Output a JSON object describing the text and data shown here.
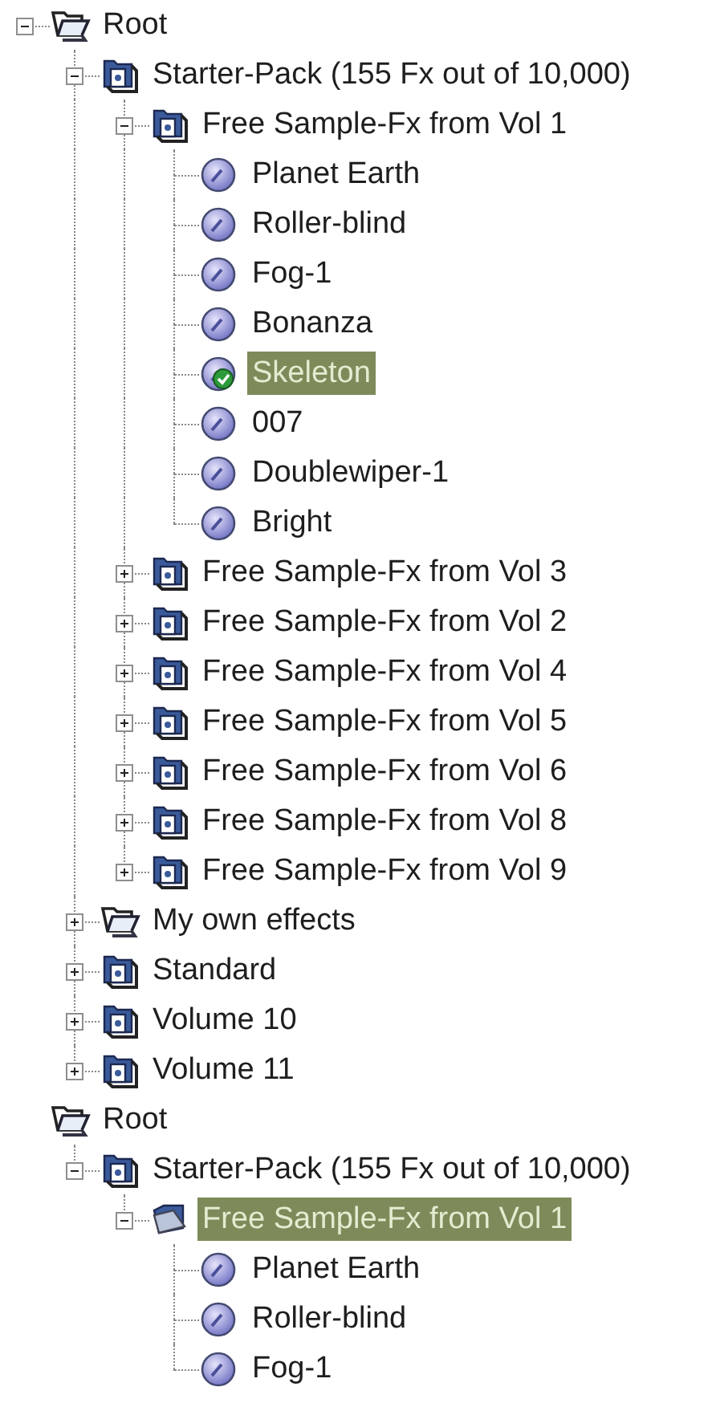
{
  "panels": [
    {
      "nodes": [
        {
          "label": "Root",
          "kind": "folder",
          "expanded": true,
          "selected": false,
          "children": [
            {
              "label": "Starter-Pack (155 Fx out of 10,000)",
              "kind": "volume",
              "expanded": true,
              "selected": false,
              "children": [
                {
                  "label": "Free Sample-Fx from Vol 1",
                  "kind": "volume",
                  "expanded": true,
                  "selected": false,
                  "children": [
                    {
                      "label": "Planet Earth",
                      "kind": "effect",
                      "selected": false
                    },
                    {
                      "label": "Roller-blind",
                      "kind": "effect",
                      "selected": false
                    },
                    {
                      "label": "Fog-1",
                      "kind": "effect",
                      "selected": false
                    },
                    {
                      "label": "Bonanza",
                      "kind": "effect",
                      "selected": false
                    },
                    {
                      "label": "Skeleton",
                      "kind": "active-effect",
                      "selected": true
                    },
                    {
                      "label": "007",
                      "kind": "effect",
                      "selected": false
                    },
                    {
                      "label": "Doublewiper-1",
                      "kind": "effect",
                      "selected": false
                    },
                    {
                      "label": "Bright",
                      "kind": "effect",
                      "selected": false
                    }
                  ]
                },
                {
                  "label": "Free Sample-Fx from Vol 3",
                  "kind": "volume",
                  "expanded": false,
                  "selected": false
                },
                {
                  "label": "Free Sample-Fx from Vol 2",
                  "kind": "volume",
                  "expanded": false,
                  "selected": false
                },
                {
                  "label": "Free Sample-Fx from Vol 4",
                  "kind": "volume",
                  "expanded": false,
                  "selected": false
                },
                {
                  "label": "Free Sample-Fx from Vol 5",
                  "kind": "volume",
                  "expanded": false,
                  "selected": false
                },
                {
                  "label": "Free Sample-Fx from Vol 6",
                  "kind": "volume",
                  "expanded": false,
                  "selected": false
                },
                {
                  "label": "Free Sample-Fx from Vol 8",
                  "kind": "volume",
                  "expanded": false,
                  "selected": false
                },
                {
                  "label": "Free Sample-Fx from Vol 9",
                  "kind": "volume",
                  "expanded": false,
                  "selected": false
                }
              ]
            },
            {
              "label": "My own effects",
              "kind": "folder",
              "expanded": false,
              "selected": false
            },
            {
              "label": "Standard",
              "kind": "volume",
              "expanded": false,
              "selected": false
            },
            {
              "label": "Volume 10",
              "kind": "volume",
              "expanded": false,
              "selected": false
            },
            {
              "label": "Volume 11",
              "kind": "volume",
              "expanded": false,
              "selected": false
            }
          ]
        }
      ]
    },
    {
      "nodes": [
        {
          "label": "Root",
          "kind": "folder",
          "selected": false,
          "children": [
            {
              "label": "Starter-Pack (155 Fx out of 10,000)",
              "kind": "volume",
              "expanded": true,
              "selected": false,
              "children": [
                {
                  "label": "Free Sample-Fx from Vol 1",
                  "kind": "open-folder",
                  "expanded": true,
                  "selected": true,
                  "children": [
                    {
                      "label": "Planet Earth",
                      "kind": "effect",
                      "selected": false
                    },
                    {
                      "label": "Roller-blind",
                      "kind": "effect",
                      "selected": false
                    },
                    {
                      "label": "Fog-1",
                      "kind": "effect",
                      "selected": false
                    }
                  ]
                }
              ]
            }
          ]
        }
      ]
    }
  ]
}
